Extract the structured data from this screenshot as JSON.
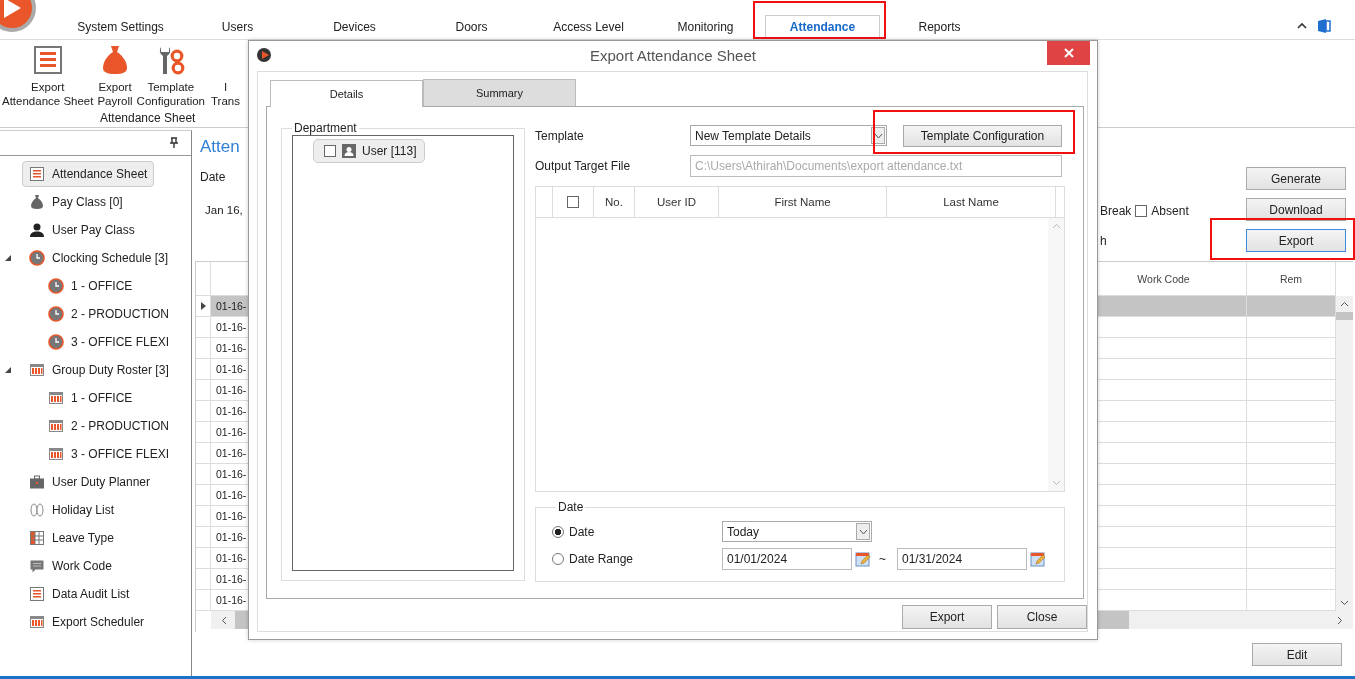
{
  "app_tabs": [
    {
      "label": "System Settings",
      "selected": false,
      "highlighted": false
    },
    {
      "label": "Users",
      "selected": false,
      "highlighted": false
    },
    {
      "label": "Devices",
      "selected": false,
      "highlighted": false
    },
    {
      "label": "Doors",
      "selected": false,
      "highlighted": false
    },
    {
      "label": "Access Level",
      "selected": false,
      "highlighted": false
    },
    {
      "label": "Monitoring",
      "selected": false,
      "highlighted": false
    },
    {
      "label": "Attendance",
      "selected": true,
      "highlighted": true
    },
    {
      "label": "Reports",
      "selected": false,
      "highlighted": false
    }
  ],
  "ribbon": {
    "items": [
      {
        "kind": "sheet",
        "lines": [
          "Export",
          "Attendance Sheet"
        ]
      },
      {
        "kind": "moneybag",
        "lines": [
          "Export",
          "Payroll"
        ]
      },
      {
        "kind": "tools",
        "lines": [
          "Template",
          "Configuration"
        ]
      },
      {
        "kind": "cut",
        "lines": [
          "I",
          "Trans"
        ]
      }
    ],
    "group_label": "Attendance Sheet"
  },
  "sidebar": {
    "items": [
      {
        "label": "Attendance Sheet",
        "kind": "sheet",
        "selected": true
      },
      {
        "label": "Pay Class [0]",
        "kind": "moneybag",
        "selected": false
      },
      {
        "label": "User Pay Class",
        "kind": "person",
        "selected": false
      },
      {
        "label": "Clocking Schedule [3]",
        "kind": "clock",
        "selected": false,
        "expanded": true,
        "children": [
          {
            "label": "1 - OFFICE",
            "kind": "clock",
            "selected": false
          },
          {
            "label": "2 - PRODUCTION",
            "kind": "clock",
            "selected": false
          },
          {
            "label": "3 - OFFICE FLEXI",
            "kind": "clock",
            "selected": false
          }
        ]
      },
      {
        "label": "Group Duty Roster [3]",
        "kind": "roster",
        "selected": false,
        "expanded": true,
        "children": [
          {
            "label": "1 - OFFICE",
            "kind": "roster",
            "selected": false
          },
          {
            "label": "2 - PRODUCTION",
            "kind": "roster",
            "selected": false
          },
          {
            "label": "3 - OFFICE FLEXI",
            "kind": "roster",
            "selected": false
          }
        ]
      },
      {
        "label": "User Duty Planner",
        "kind": "briefcase",
        "selected": false
      },
      {
        "label": "Holiday List",
        "kind": "sandals",
        "selected": false
      },
      {
        "label": "Leave Type",
        "kind": "grid",
        "selected": false
      },
      {
        "label": "Work Code",
        "kind": "chat",
        "selected": false
      },
      {
        "label": "Data Audit List",
        "kind": "sheet",
        "selected": false
      },
      {
        "label": "Export Scheduler",
        "kind": "roster",
        "selected": false
      }
    ]
  },
  "main": {
    "title": "Atten",
    "date_label": "Date",
    "date_value": "Jan 16,",
    "break_label": "Break",
    "absent": {
      "label": "Absent",
      "checked": false
    },
    "cut_text": "h",
    "buttons": [
      {
        "label": "Generate",
        "highlighted": false,
        "focused": false
      },
      {
        "label": "Download",
        "highlighted": false,
        "focused": false
      },
      {
        "label": "Export",
        "highlighted": true,
        "focused": true
      }
    ],
    "grid": {
      "columns": [
        "Work Code",
        "Rem"
      ],
      "rows": [
        {
          "date": "01-16-",
          "selected": true
        },
        {
          "date": "01-16-",
          "selected": false
        },
        {
          "date": "01-16-",
          "selected": false
        },
        {
          "date": "01-16-",
          "selected": false
        },
        {
          "date": "01-16-",
          "selected": false
        },
        {
          "date": "01-16-",
          "selected": false
        },
        {
          "date": "01-16-",
          "selected": false
        },
        {
          "date": "01-16-",
          "selected": false
        },
        {
          "date": "01-16-",
          "selected": false
        },
        {
          "date": "01-16-",
          "selected": false
        },
        {
          "date": "01-16-",
          "selected": false
        },
        {
          "date": "01-16-",
          "selected": false
        },
        {
          "date": "01-16-",
          "selected": false
        },
        {
          "date": "01-16-",
          "selected": false
        },
        {
          "date": "01-16-",
          "selected": false
        }
      ]
    },
    "edit_button": "Edit"
  },
  "dialog": {
    "title": "Export Attendance Sheet",
    "tabs": [
      {
        "label": "Details",
        "selected": true
      },
      {
        "label": "Summary",
        "selected": false
      }
    ],
    "department": {
      "legend": "Department",
      "items": [
        {
          "label": "User [113]",
          "checked": false,
          "selected": true
        }
      ]
    },
    "template": {
      "label": "Template",
      "value": "New Template Details",
      "button": {
        "label": "Template Configuration",
        "highlighted": true
      }
    },
    "output": {
      "label": "Output Target File",
      "value": "C:\\Users\\Athirah\\Documents\\export attendance.txt",
      "disabled": true
    },
    "users_grid": {
      "header_checked": false,
      "columns": [
        "No.",
        "User ID",
        "First Name",
        "Last Name"
      ]
    },
    "date_group": {
      "legend": "Date",
      "options": [
        {
          "label": "Date",
          "selected": true
        },
        {
          "label": "Date Range",
          "selected": false
        }
      ],
      "preset": "Today",
      "from": "01/01/2024",
      "separator": "~",
      "to": "01/31/2024"
    },
    "buttons": [
      "Export",
      "Close"
    ]
  }
}
